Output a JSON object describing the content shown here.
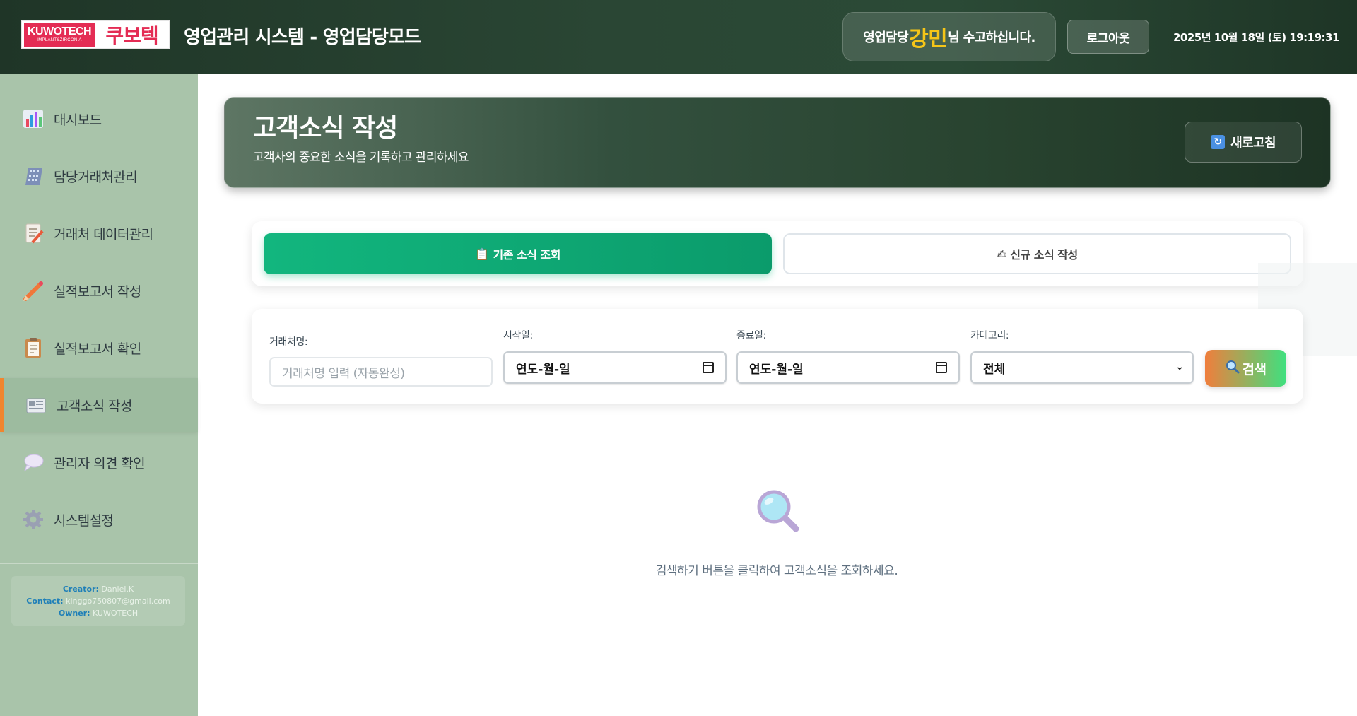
{
  "header": {
    "logo_text_top": "KUWOTECH",
    "logo_text_bottom": "IMPLANT&ZIRCONIA",
    "logo_korean": "쿠보텍",
    "app_title": "영업관리 시스템 - 영업담당모드",
    "welcome_prefix": "영업담당",
    "welcome_name": "강민",
    "welcome_suffix": "님 수고하십니다.",
    "logout_label": "로그아웃",
    "datetime": "2025년 10월 18일 (토) 19:19:31",
    "accent_color": "#f5c518"
  },
  "sidebar": {
    "items": [
      {
        "label": "대시보드",
        "icon": "bar-chart-icon"
      },
      {
        "label": "담당거래처관리",
        "icon": "office-building-icon"
      },
      {
        "label": "거래처 데이터관리",
        "icon": "document-edit-icon"
      },
      {
        "label": "실적보고서 작성",
        "icon": "pencil-icon"
      },
      {
        "label": "실적보고서 확인",
        "icon": "clipboard-icon"
      },
      {
        "label": "고객소식 작성",
        "icon": "newspaper-icon",
        "active": true
      },
      {
        "label": "관리자 의견 확인",
        "icon": "speech-bubble-icon"
      },
      {
        "label": "시스템설정",
        "icon": "gear-icon"
      }
    ],
    "credit": {
      "creator_key": "Creator:",
      "creator_val": "Daniel.K",
      "contact_key": "Contact:",
      "contact_val": "kinggo750807@gmail.com",
      "owner_key": "Owner:",
      "owner_val": "KUWOTECH"
    }
  },
  "banner": {
    "title": "고객소식 작성",
    "subtitle": "고객사의 중요한 소식을 기록하고 관리하세요",
    "refresh_label": "새로고침"
  },
  "tabs": {
    "view": {
      "icon": "📋",
      "label": "기존 소식 조회"
    },
    "write": {
      "icon": "✍",
      "label": "신규 소식 작성"
    }
  },
  "filters": {
    "client_label": "거래처명:",
    "client_placeholder": "거래처명 입력 (자동완성)",
    "start_label": "시작일:",
    "start_value": "연도-월-일",
    "end_label": "종료일:",
    "end_value": "연도-월-일",
    "category_label": "카테고리:",
    "category_value": "전체",
    "search_label": "검색"
  },
  "empty_state": {
    "message": "검색하기 버튼을 클릭하여 고객소식을 조회하세요."
  },
  "colors": {
    "header_bg": "#2a4634",
    "sidebar_bg": "#a9c4aa",
    "active_tab": "#12b67e",
    "active_marker": "#f1852e"
  }
}
